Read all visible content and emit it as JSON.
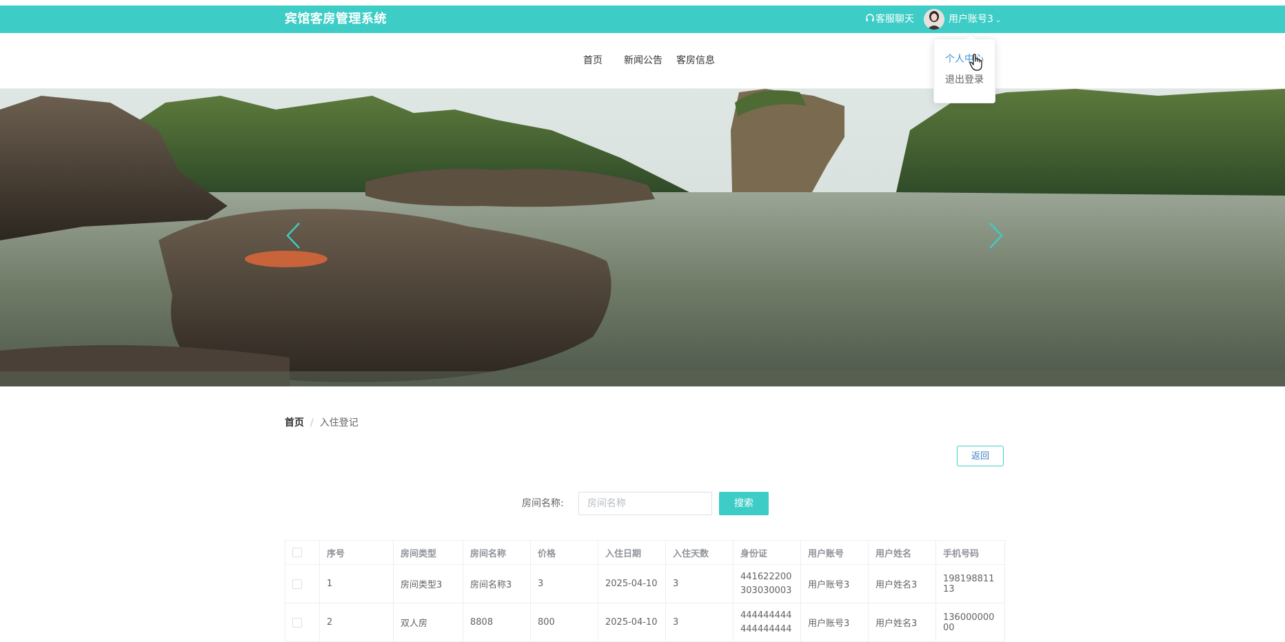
{
  "header": {
    "title": "宾馆客房管理系统",
    "chat_label": "客服聊天",
    "user_label": "用户账号3",
    "accent_color": "#3dcdc6"
  },
  "nav": {
    "items": [
      "首页",
      "新闻公告",
      "客房信息"
    ]
  },
  "dropdown": {
    "items": [
      "个人中心",
      "退出登录"
    ]
  },
  "breadcrumb": {
    "home": "首页",
    "separator": "/",
    "current": "入住登记"
  },
  "back_label": "返回",
  "search": {
    "label": "房间名称:",
    "placeholder": "房间名称",
    "button_label": "搜索"
  },
  "table": {
    "headers": [
      "序号",
      "房间类型",
      "房间名称",
      "价格",
      "入住日期",
      "入住天数",
      "身份证",
      "用户账号",
      "用户姓名",
      "手机号码"
    ],
    "rows": [
      [
        "1",
        "房间类型3",
        "房间名称3",
        "3",
        "2025-04-10",
        "3",
        "441622200303030003",
        "用户账号3",
        "用户姓名3",
        "19819881113"
      ],
      [
        "2",
        "双人房",
        "8808",
        "800",
        "2025-04-10",
        "3",
        "444444444444444444",
        "用户账号3",
        "用户姓名3",
        "13600000000"
      ]
    ]
  }
}
